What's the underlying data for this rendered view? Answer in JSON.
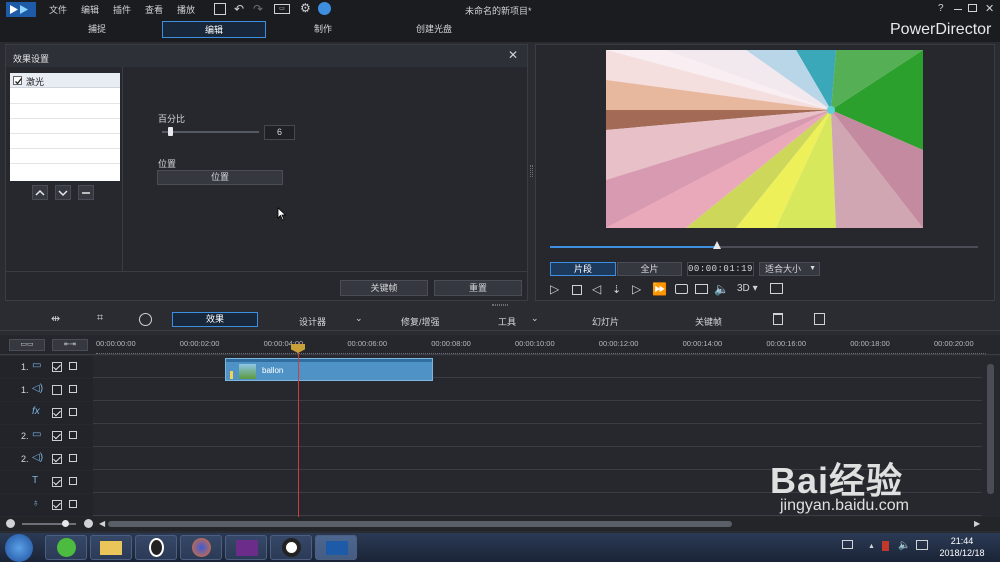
{
  "menu": {
    "items": [
      "文件",
      "编辑",
      "插件",
      "查看",
      "播放"
    ],
    "project_title": "未命名的新项目*"
  },
  "modes": [
    "捕捉",
    "编辑",
    "制作",
    "创建光盘"
  ],
  "brand": "PowerDirector",
  "effects_panel": {
    "title": "效果设置",
    "effect_name": "激光",
    "percent_label": "百分比",
    "percent_value": "6",
    "percent_fraction": 0.06,
    "position_label": "位置",
    "position_button": "位置",
    "keyframe_button": "关键帧",
    "reset_button": "重置"
  },
  "preview": {
    "clip_tab": "片段",
    "movie_tab": "全片",
    "timecode": "00:00:01:19",
    "fit_label": "适合大小",
    "mode_3d": "3D",
    "scrub_fraction": 0.39
  },
  "toolbar": {
    "effect": "效果",
    "designer": "设计器",
    "repair": "修复/增强",
    "tools": "工具",
    "slideshow": "幻灯片",
    "keyframe": "关键帧"
  },
  "timeline": {
    "ruler": [
      "00:00:00:00",
      "00:00:02:00",
      "00:00:04:00",
      "00:00:06:00",
      "00:00:08:00",
      "00:00:10:00",
      "00:00:12:00",
      "00:00:14:00",
      "00:00:16:00",
      "00:00:18:00",
      "00:00:20:00"
    ],
    "tracks": [
      {
        "label": "1.",
        "icon": "video-track-icon",
        "checked": true
      },
      {
        "label": "1.",
        "icon": "audio-track-icon",
        "checked": false
      },
      {
        "label": "",
        "icon": "fx-track-icon",
        "checked": true
      },
      {
        "label": "2.",
        "icon": "video-track-icon",
        "checked": true
      },
      {
        "label": "2.",
        "icon": "audio-track-icon",
        "checked": true
      },
      {
        "label": "",
        "icon": "title-track-icon",
        "checked": true
      },
      {
        "label": "",
        "icon": "voice-track-icon",
        "checked": true
      }
    ],
    "clip_name": "ballon"
  },
  "taskbar": {
    "time": "21:44",
    "date": "2018/12/18"
  },
  "watermark": {
    "text": "Bai经验",
    "url": "jingyan.baidu.com"
  },
  "colors": {
    "accent": "#3e8fe0",
    "clip": "#4f93c6",
    "playhead": "#d43b3b"
  }
}
